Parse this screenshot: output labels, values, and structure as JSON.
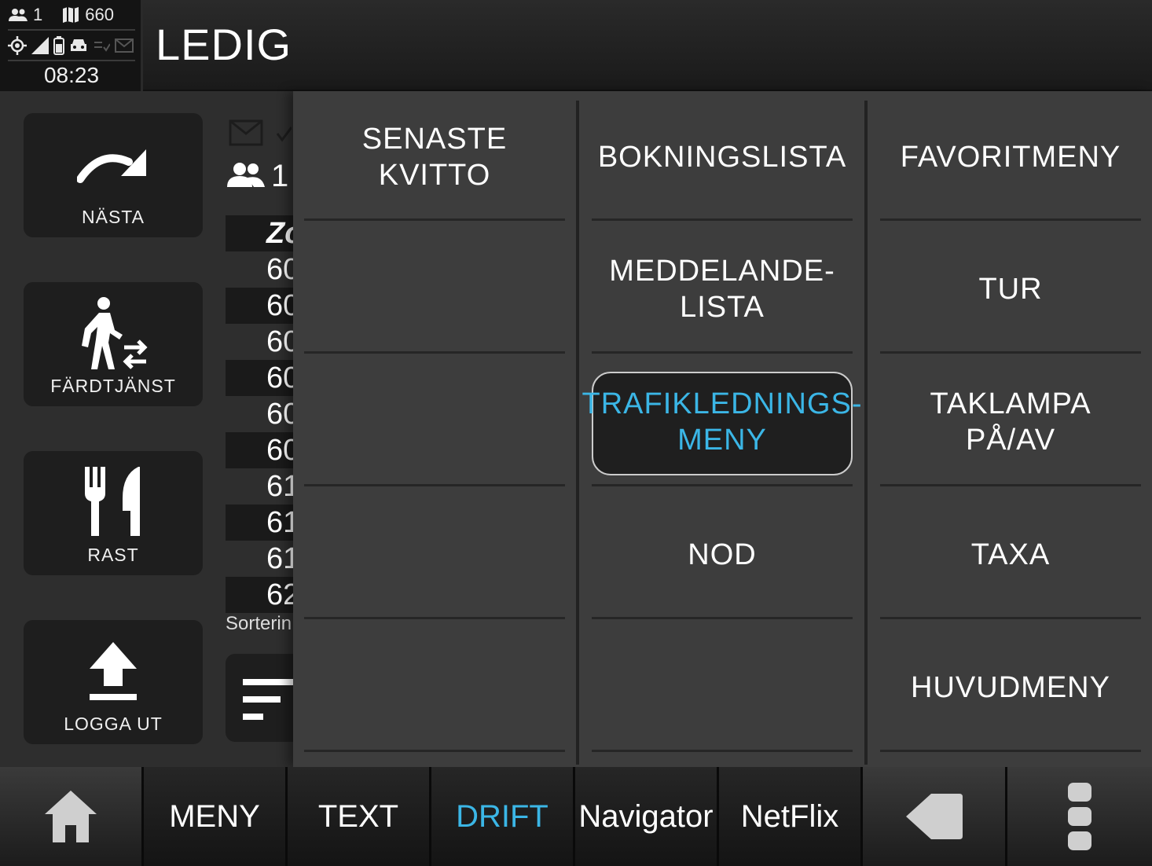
{
  "status": {
    "passengers": "1",
    "vehicle_number": "660",
    "time": "08:23"
  },
  "header": {
    "title": "LEDIG"
  },
  "side_actions": [
    {
      "label": "NÄSTA",
      "icon": "redo-arrow-icon"
    },
    {
      "label": "FÄRDTJÄNST",
      "icon": "walking-transfer-icon"
    },
    {
      "label": "RAST",
      "icon": "fork-knife-icon"
    },
    {
      "label": "LOGGA UT",
      "icon": "upload-icon"
    }
  ],
  "middle_list": {
    "passenger_count": "1",
    "header": "Zo",
    "rows": [
      "60",
      "60",
      "60",
      "60",
      "60",
      "60",
      "61",
      "61",
      "61",
      "62"
    ],
    "sort_label": "Sorterin"
  },
  "menu": {
    "col1": [
      "SENASTE\nKVITTO",
      "",
      "",
      "",
      ""
    ],
    "col2": [
      "BOKNINGSLISTA",
      "MEDDELANDE-\nLISTA",
      "TRAFIKLEDNINGS-\nMENY",
      "NOD",
      ""
    ],
    "col3": [
      "FAVORITMENY",
      "TUR",
      "TAKLAMPA\nPÅ/AV",
      "TAXA",
      "HUVUDMENY"
    ],
    "active": "TRAFIKLEDNINGS-\nMENY"
  },
  "bottom_tabs": {
    "menu": "MENY",
    "text": "TEXT",
    "drift": "DRIFT",
    "navigator": "Navigator",
    "netflix": "NetFlix"
  },
  "colors": {
    "accent": "#3bb6e6",
    "panel": "#3d3d3d",
    "button": "#1e1e1e"
  }
}
